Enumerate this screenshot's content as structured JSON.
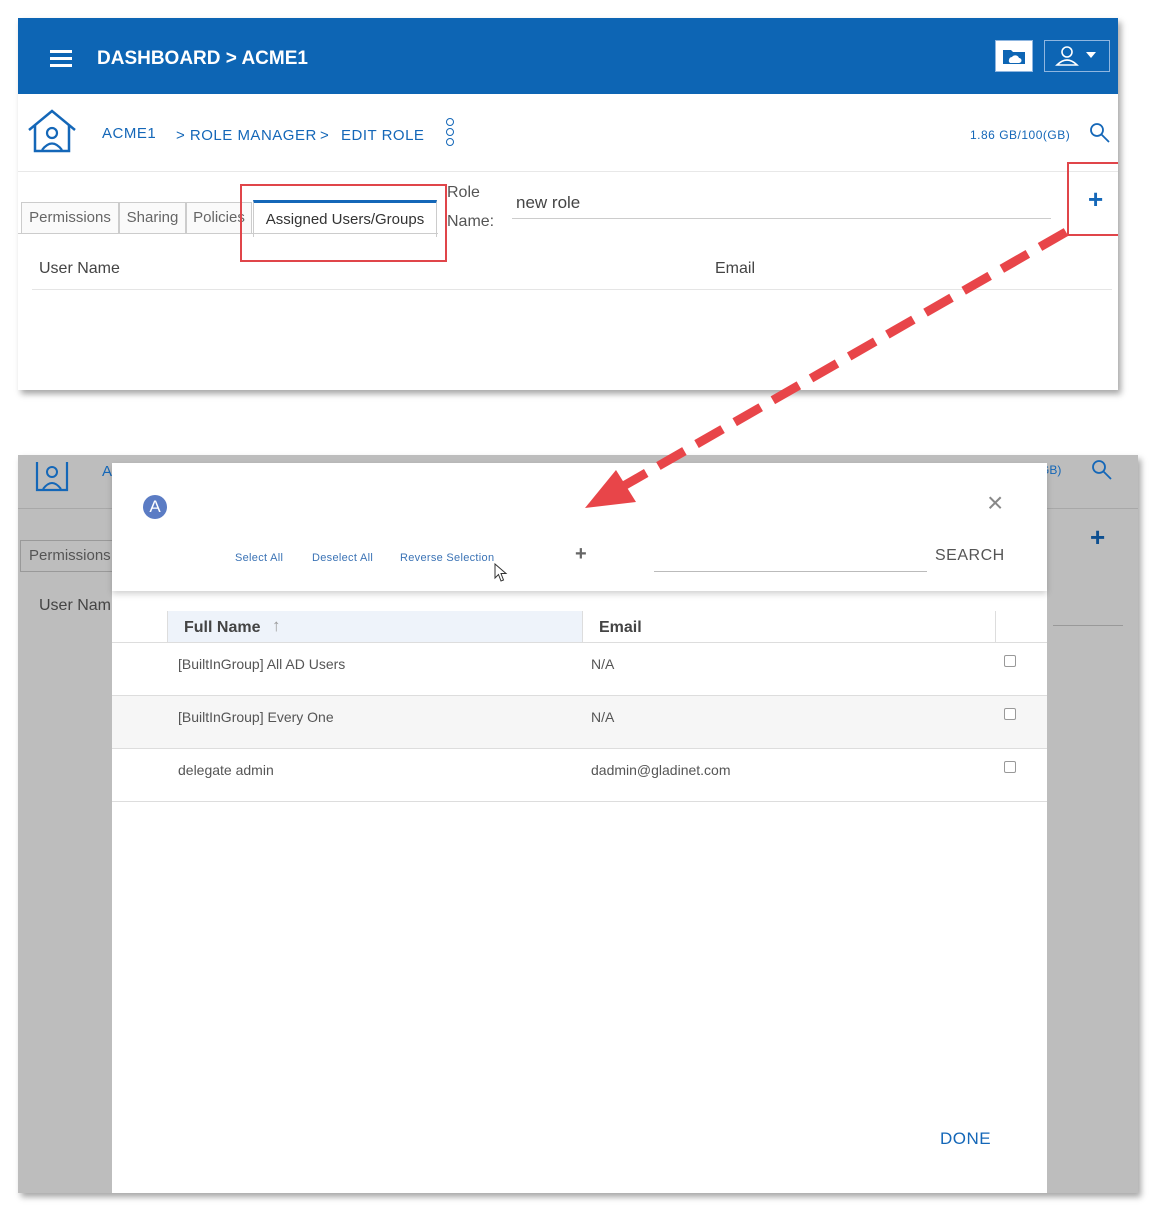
{
  "header": {
    "title": "DASHBOARD > ACME1"
  },
  "breadcrumb": {
    "home": "ACME1",
    "role_manager": "> ROLE MANAGER",
    "sep": ">",
    "edit_role": "EDIT ROLE"
  },
  "storage": {
    "usage": "1.86 GB/100(GB)"
  },
  "tabs": [
    "Permissions",
    "Sharing",
    "Policies",
    "Assigned Users/Groups"
  ],
  "role": {
    "label_line1": "Role",
    "label_line2": "Name:",
    "value": "new role"
  },
  "table": {
    "col_user": "User Name",
    "col_email": "Email"
  },
  "background": {
    "breadcrumb_partial": "A",
    "storage_partial": ")(GB)",
    "tab_partial": "Permissions",
    "col_user_partial": "User Nam"
  },
  "dialog": {
    "badge": "A",
    "close": "×",
    "actions": {
      "select_all": "Select All",
      "deselect_all": "Deselect All",
      "reverse_selection": "Reverse Selection",
      "add": "+"
    },
    "search": {
      "label": "SEARCH",
      "value": ""
    },
    "columns": {
      "full_name": "Full Name",
      "sort_arrow": "↑",
      "email": "Email"
    },
    "rows": [
      {
        "name": "[BuiltInGroup] All AD Users",
        "email": "N/A"
      },
      {
        "name": "[BuiltInGroup] Every One",
        "email": "N/A"
      },
      {
        "name": "delegate admin",
        "email": "dadmin@gladinet.com"
      }
    ],
    "done": "DONE"
  },
  "colors": {
    "brand_blue": "#0d65b4",
    "link_blue": "#1467b8",
    "highlight_red": "#e0454a"
  },
  "icons": [
    "menu-icon",
    "cloud-folder-icon",
    "user-icon",
    "chevron-down-icon",
    "home-icon",
    "more-vert-icon",
    "search-icon",
    "plus-icon",
    "close-icon",
    "sort-up-icon",
    "mouse-cursor-icon"
  ]
}
